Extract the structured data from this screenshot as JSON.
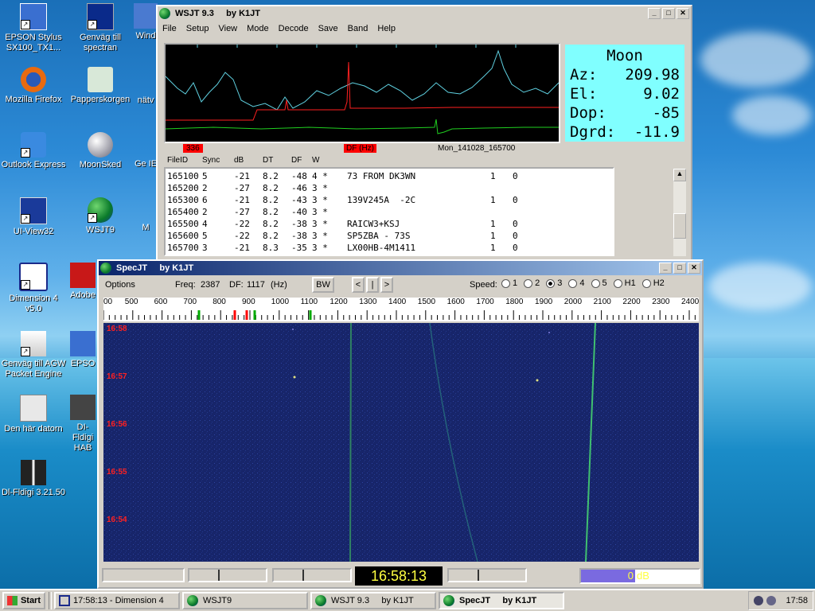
{
  "desktop": {
    "icons": [
      {
        "label": "EPSON Stylus SX100_TX1...",
        "icon": "printer-icon"
      },
      {
        "label": "Genväg till spectran",
        "icon": "spectrum-icon"
      },
      {
        "label": "Wind",
        "icon": "window-icon"
      },
      {
        "label": "Mozilla Firefox",
        "icon": "firefox-icon"
      },
      {
        "label": "Papperskorgen",
        "icon": "recycle-bin-icon"
      },
      {
        "label": "nätv",
        "icon": "network-icon"
      },
      {
        "label": "Outlook Express",
        "icon": "outlook-icon"
      },
      {
        "label": "MoonSked",
        "icon": "moon-icon"
      },
      {
        "label": "Ge IE",
        "icon": "ie-icon"
      },
      {
        "label": "UI-View32",
        "icon": "uiview-icon"
      },
      {
        "label": "WSJT9",
        "icon": "globe-icon"
      },
      {
        "label": "M",
        "icon": "app-icon"
      },
      {
        "label": "Dimension 4 v5.0",
        "icon": "clock-icon"
      },
      {
        "label": "Adobe",
        "icon": "adobe-icon"
      },
      {
        "label": "Genväg till AGW Packet Engine",
        "icon": "antenna-icon"
      },
      {
        "label": "EPSO",
        "icon": "printer-icon"
      },
      {
        "label": "Den här datorn",
        "icon": "computer-icon"
      },
      {
        "label": "DI-Fldigi HAB",
        "icon": "balloon-icon"
      },
      {
        "label": "Dl-Fldigi 3.21.50",
        "icon": "fldigi-icon"
      }
    ]
  },
  "wsjt": {
    "title": "WSJT 9.3     by K1JT",
    "menu": [
      "File",
      "Setup",
      "View",
      "Mode",
      "Decode",
      "Save",
      "Band",
      "Help"
    ],
    "moon": {
      "title": "Moon",
      "rows": [
        {
          "label": "Az:",
          "value": "209.98"
        },
        {
          "label": "El:",
          "value": "9.02"
        },
        {
          "label": "Dop:",
          "value": "-85"
        },
        {
          "label": "Dgrd:",
          "value": "-11.9"
        }
      ]
    },
    "plot_marker_left": "336",
    "plot_marker_df": "DF (Hz)",
    "plot_file": "Mon_141028_165700",
    "columns": [
      "FileID",
      "Sync",
      "dB",
      "DT",
      "DF",
      "W"
    ],
    "rows": [
      {
        "id": "165100",
        "sync": "5",
        "db": "-21",
        "dt": "8.2",
        "df": "-48",
        "w": "4 *",
        "msg": "73 FROM DK3WN",
        "a": "1",
        "b": "0"
      },
      {
        "id": "165200",
        "sync": "2",
        "db": "-27",
        "dt": "8.2",
        "df": "-46",
        "w": "3 *",
        "msg": "",
        "a": "",
        "b": ""
      },
      {
        "id": "165300",
        "sync": "6",
        "db": "-21",
        "dt": "8.2",
        "df": "-43",
        "w": "3 *",
        "msg": "139V245A  -2C",
        "a": "1",
        "b": "0"
      },
      {
        "id": "165400",
        "sync": "2",
        "db": "-27",
        "dt": "8.2",
        "df": "-40",
        "w": "3 *",
        "msg": "",
        "a": "",
        "b": ""
      },
      {
        "id": "165500",
        "sync": "4",
        "db": "-22",
        "dt": "8.2",
        "df": "-38",
        "w": "3 *",
        "msg": "RAICW3+KSJ",
        "a": "1",
        "b": "0"
      },
      {
        "id": "165600",
        "sync": "5",
        "db": "-22",
        "dt": "8.2",
        "df": "-38",
        "w": "3 *",
        "msg": "SP5ZBA - 73S",
        "a": "1",
        "b": "0"
      },
      {
        "id": "165700",
        "sync": "3",
        "db": "-21",
        "dt": "8.3",
        "df": "-35",
        "w": "3 *",
        "msg": "LX00HB-4M1411",
        "a": "1",
        "b": "0"
      }
    ]
  },
  "specjt": {
    "title": "SpecJT     by K1JT",
    "options": "Options",
    "freq_label": "Freq:",
    "freq_value": "2387",
    "df_label": "DF:",
    "df_value": "1117",
    "df_unit": "(Hz)",
    "bw_button": "BW",
    "nav_buttons": [
      "<",
      "|",
      ">"
    ],
    "speed_label": "Speed:",
    "speed_options": [
      "1",
      "2",
      "3",
      "4",
      "5",
      "H1",
      "H2"
    ],
    "speed_selected": "3",
    "freq_ticks": [
      "00",
      "500",
      "600",
      "700",
      "800",
      "900",
      "1000",
      "1100",
      "1200",
      "1300",
      "1400",
      "1500",
      "1600",
      "1700",
      "1800",
      "1900",
      "2000",
      "2100",
      "2200",
      "2300",
      "2400"
    ],
    "time_labels": [
      "16:58",
      "16:57",
      "16:56",
      "16:55",
      "16:54"
    ],
    "clock": "16:58:13",
    "level_value": "0",
    "level_unit": "dB"
  },
  "taskbar": {
    "start": "Start",
    "tasks": [
      {
        "label": "17:58:13 - Dimension 4",
        "icon": "clock-icon"
      },
      {
        "label": "WSJT9",
        "icon": "globe-icon"
      },
      {
        "label": "WSJT 9.3     by K1JT",
        "icon": "globe-icon"
      },
      {
        "label": "SpecJT     by K1JT",
        "icon": "globe-icon"
      }
    ],
    "tray_time": "17:58"
  }
}
